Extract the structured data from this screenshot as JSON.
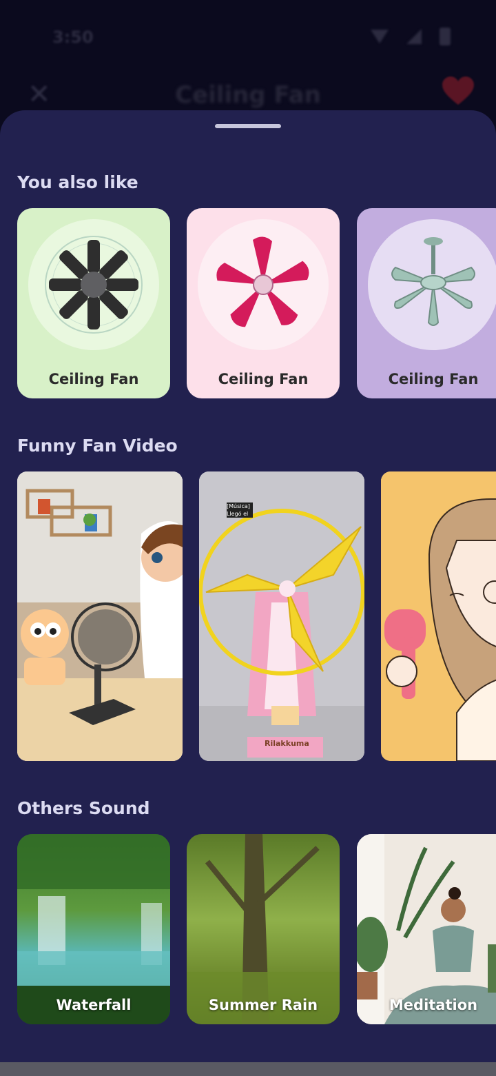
{
  "status_bar": {
    "time": "3:50"
  },
  "background_screen": {
    "title": "Ceiling Fan"
  },
  "sections": {
    "you_also_like": {
      "title": "You also like",
      "items": [
        {
          "label": "Ceiling Fan",
          "bg": "#d8f1c8"
        },
        {
          "label": "Ceiling Fan",
          "bg": "#fde0ea"
        },
        {
          "label": "Ceiling Fan",
          "bg": "#c2addf"
        }
      ]
    },
    "funny_fan_video": {
      "title": "Funny Fan Video",
      "video2_caption": [
        "[Música]",
        "Llegó el"
      ],
      "video2_brand": "Rilakkuma"
    },
    "others_sound": {
      "title": "Others Sound",
      "items": [
        {
          "label": "Waterfall"
        },
        {
          "label": "Summer Rain"
        },
        {
          "label": "Meditation"
        }
      ]
    }
  },
  "colors": {
    "sheet_bg": "#22214f",
    "accent_heart": "#d62d50"
  },
  "icons": [
    "close-icon",
    "heart-icon",
    "wifi-icon",
    "signal-icon",
    "battery-icon"
  ]
}
